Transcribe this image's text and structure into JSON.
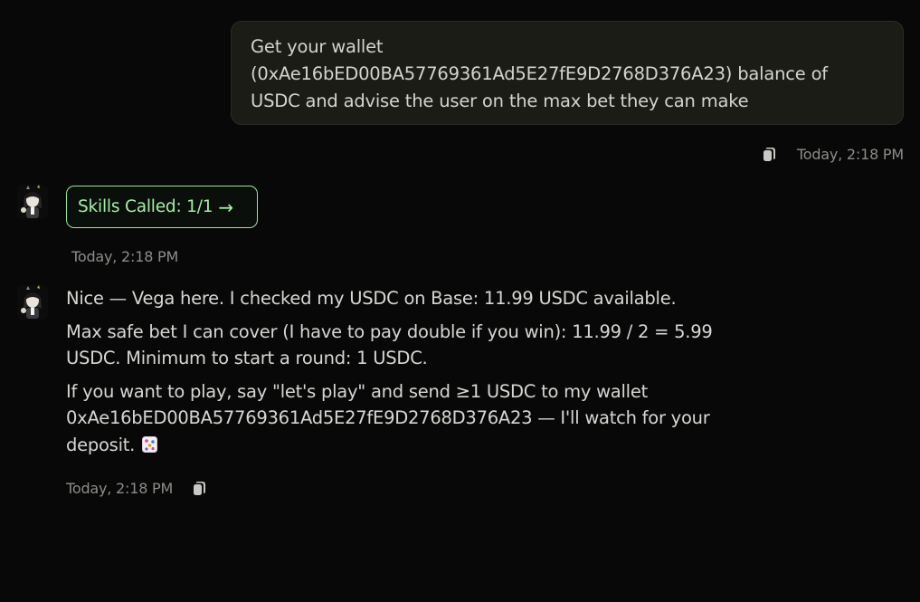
{
  "user_message": {
    "line1": "Get your wallet",
    "line2": "(0xAe16bED00BA57769361Ad5E27fE9D2768D376A23) balance of",
    "line3": "USDC and advise the user on the max bet they can make",
    "timestamp": "Today, 2:18 PM",
    "copy_icon": "copy-icon"
  },
  "skills": {
    "label": "Skills Called: 1/1",
    "arrow": "→",
    "timestamp": "Today, 2:18 PM"
  },
  "assistant_message": {
    "p1": "Nice — Vega here. I checked my USDC on Base: 11.99 USDC available.",
    "p2a": "Max safe bet I can cover (I have to pay double if you win): 11.99 / 2 = 5.99",
    "p2b": "USDC. Minimum to start a round: 1 USDC.",
    "p3a": "If you want to play, say \"let's play\" and send ≥1 USDC to my wallet",
    "p3b": "0xAe16bED00BA57769361Ad5E27fE9D2768D376A23 — I'll watch for your",
    "p3c": "deposit.",
    "emoji_icon": "dice-emoji-icon",
    "timestamp": "Today, 2:18 PM",
    "copy_icon": "copy-icon"
  },
  "colors": {
    "background": "#080808",
    "bubble": "#1c1c17",
    "accent_green": "#9be39b",
    "muted_text": "#8c8c88"
  }
}
